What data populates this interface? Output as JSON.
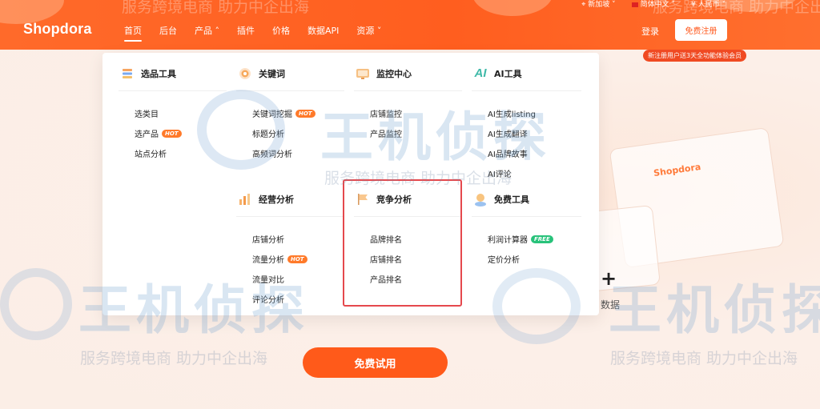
{
  "header": {
    "logo": "Shopdora",
    "nav": [
      {
        "label": "首页",
        "active": true
      },
      {
        "label": "后台"
      },
      {
        "label": "产品 ˄"
      },
      {
        "label": "插件"
      },
      {
        "label": "价格"
      },
      {
        "label": "数据API"
      },
      {
        "label": "资源 ˅"
      }
    ],
    "utility": {
      "region": "新加坡 ˅",
      "language": "简体中文 ˅",
      "currency": "¥ 人民币 ˅"
    },
    "login_label": "登录",
    "register_label": "免费注册",
    "promo": "新注册用户送3天全功能体验会员"
  },
  "menu": {
    "columns": [
      {
        "title": "选品工具",
        "icon": "stack-icon",
        "items": [
          {
            "label": "选类目"
          },
          {
            "label": "选产品",
            "tag": "HOT"
          },
          {
            "label": "站点分析"
          }
        ]
      },
      {
        "title": "关键词",
        "icon": "target-icon",
        "items": [
          {
            "label": "关键词挖掘",
            "tag": "HOT"
          },
          {
            "label": "标题分析"
          },
          {
            "label": "高频词分析"
          }
        ]
      },
      {
        "title": "监控中心",
        "icon": "monitor-icon",
        "items": [
          {
            "label": "店铺监控"
          },
          {
            "label": "产品监控"
          }
        ]
      },
      {
        "title": "AI工具",
        "icon": "ai-icon",
        "items": [
          {
            "label": "AI生成listing"
          },
          {
            "label": "AI生成翻译"
          },
          {
            "label": "AI品牌故事"
          },
          {
            "label": "AI评论"
          }
        ]
      },
      {
        "title": "经营分析",
        "icon": "bar-chart-icon",
        "items": [
          {
            "label": "店铺分析"
          },
          {
            "label": "流量分析",
            "tag": "HOT"
          },
          {
            "label": "流量对比"
          },
          {
            "label": "评论分析"
          }
        ]
      },
      {
        "title": "竞争分析",
        "icon": "flag-icon",
        "items": [
          {
            "label": "品牌排名"
          },
          {
            "label": "店铺排名"
          },
          {
            "label": "产品排名"
          }
        ]
      },
      {
        "title": "免费工具",
        "icon": "user-icon",
        "items": [
          {
            "label": "利润计算器",
            "tag": "FREE"
          },
          {
            "label": "定价分析"
          }
        ]
      }
    ]
  },
  "hero": {
    "plus": "+",
    "text_fragment": "数据",
    "trial_label": "免费试用",
    "card_brand": "Shopdora"
  },
  "watermark": {
    "main": "王机侦探",
    "sub": "服务跨境电商  助力中企出海"
  },
  "colors": {
    "brand": "#ff5e1f",
    "hot": "#ff7a2a",
    "free": "#28c27a",
    "highlight": "#e5484d"
  }
}
